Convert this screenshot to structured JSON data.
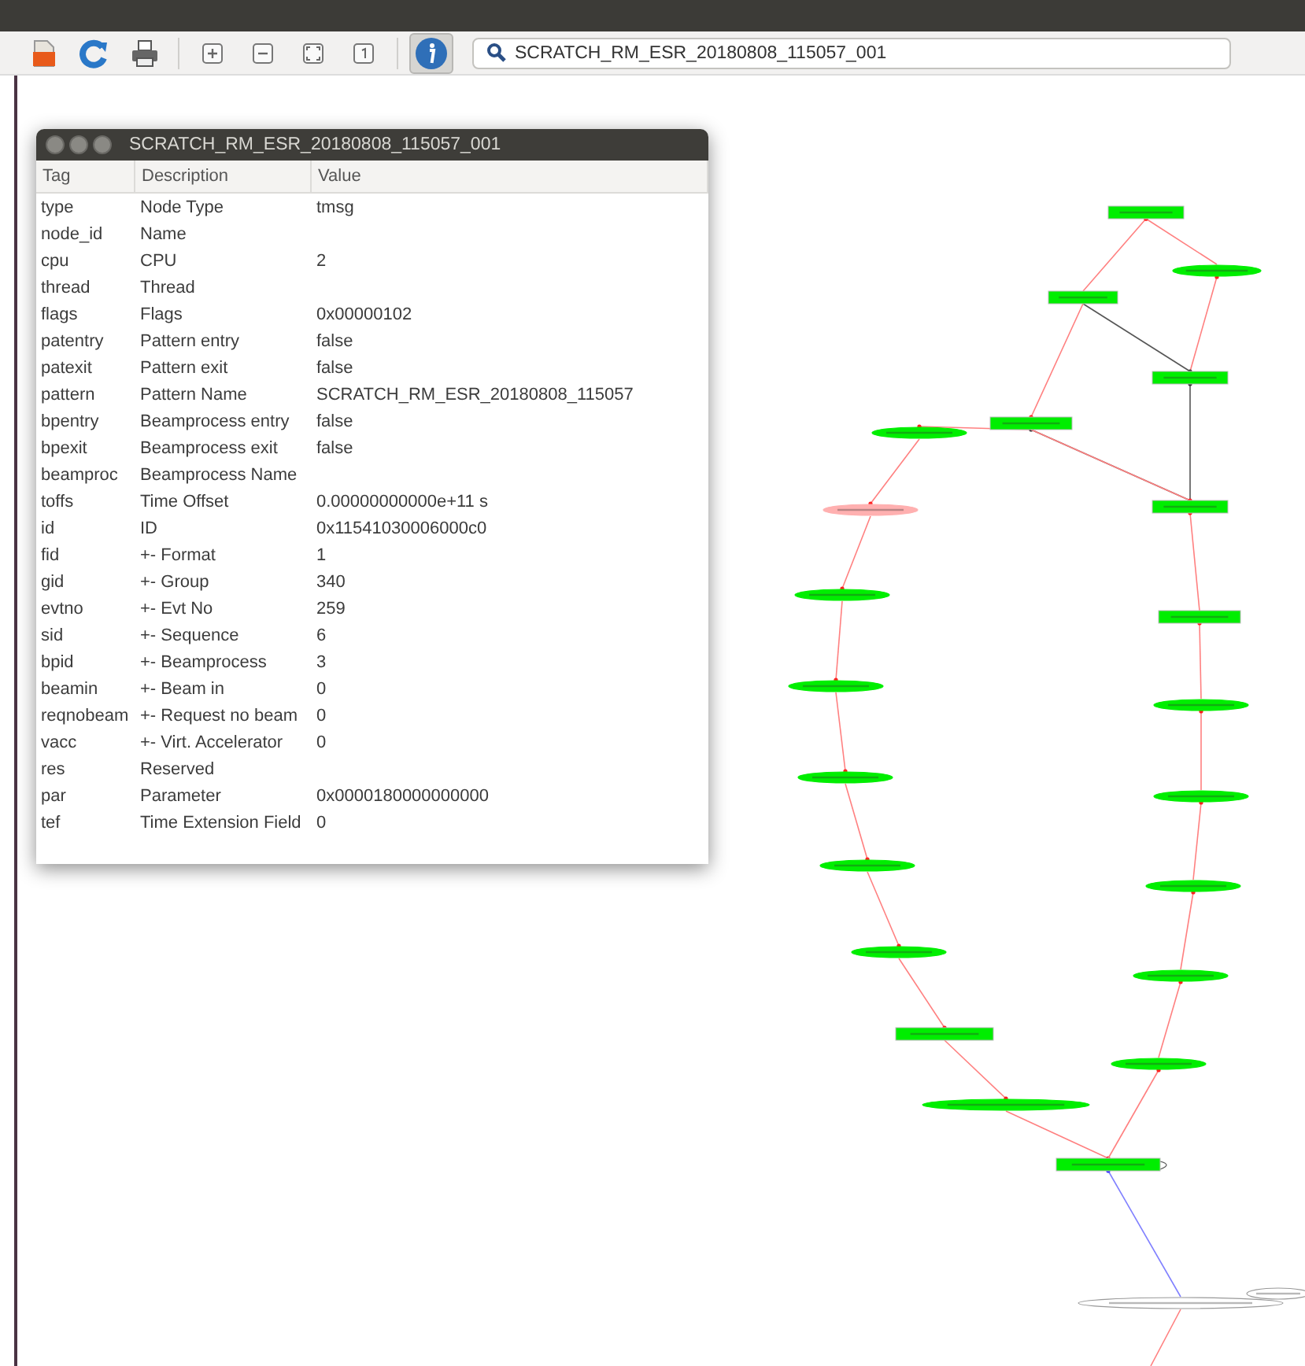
{
  "toolbar": {
    "buttons": [
      {
        "kind": "open",
        "pressed": false
      },
      {
        "kind": "reload",
        "pressed": false
      },
      {
        "kind": "print",
        "pressed": false
      },
      {
        "kind": "zoom_in",
        "pressed": false
      },
      {
        "kind": "zoom_out",
        "pressed": false
      },
      {
        "kind": "fit",
        "pressed": false
      },
      {
        "kind": "actual_size",
        "pressed": false
      },
      {
        "kind": "info",
        "pressed": true
      }
    ],
    "search": {
      "value": "SCRATCH_RM_ESR_20180808_115057_001"
    }
  },
  "info_window": {
    "title": "SCRATCH_RM_ESR_20180808_115057_001",
    "columns": [
      "Tag",
      "Description",
      "Value"
    ],
    "rows": [
      {
        "tag": "type",
        "description": "Node Type",
        "value": "tmsg"
      },
      {
        "tag": "node_id",
        "description": "Name"
      },
      {
        "tag": "cpu",
        "description": "CPU",
        "value": "2"
      },
      {
        "tag": "thread",
        "description": "Thread"
      },
      {
        "tag": "flags",
        "description": "Flags",
        "value": "0x00000102"
      },
      {
        "tag": "patentry",
        "description": "Pattern entry",
        "value": "false"
      },
      {
        "tag": "patexit",
        "description": "Pattern exit",
        "value": "false"
      },
      {
        "tag": "pattern",
        "description": "Pattern Name",
        "value": "SCRATCH_RM_ESR_20180808_115057"
      },
      {
        "tag": "bpentry",
        "description": "Beamprocess entry",
        "value": "false"
      },
      {
        "tag": "bpexit",
        "description": "Beamprocess exit",
        "value": "false"
      },
      {
        "tag": "beamproc",
        "description": "Beamprocess Name"
      },
      {
        "tag": "toffs",
        "description": "Time Offset",
        "value": "0.00000000000e+11 s"
      },
      {
        "tag": "id",
        "description": "ID",
        "value": "0x11541030006000c0"
      },
      {
        "tag": "fid",
        "description": "+- Format",
        "value": "1"
      },
      {
        "tag": "gid",
        "description": "+- Group",
        "value": "340"
      },
      {
        "tag": "evtno",
        "description": "+- Evt No",
        "value": "259"
      },
      {
        "tag": "sid",
        "description": "+- Sequence",
        "value": "6"
      },
      {
        "tag": "bpid",
        "description": "+- Beamprocess",
        "value": "3"
      },
      {
        "tag": "beamin",
        "description": "+- Beam in",
        "value": "0"
      },
      {
        "tag": "reqnobeam",
        "description": "+- Request no beam",
        "value": "0"
      },
      {
        "tag": "vacc",
        "description": "+- Virt. Accelerator",
        "value": "0"
      },
      {
        "tag": "res",
        "description": "Reserved"
      },
      {
        "tag": "par",
        "description": "Parameter",
        "value": "0x0000180000000000"
      },
      {
        "tag": "tef",
        "description": "Time Extension Field",
        "value": "0"
      }
    ]
  }
}
